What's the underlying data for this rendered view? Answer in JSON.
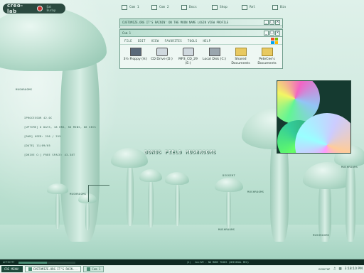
{
  "logo": {
    "name": "creo-lab",
    "tag": "Eat Burlap"
  },
  "desktop_icons": [
    {
      "label": "Com 1"
    },
    {
      "label": "Com 2"
    },
    {
      "label": "Docs"
    },
    {
      "label": "Shop"
    },
    {
      "label": "Rel"
    },
    {
      "label": "Bin"
    }
  ],
  "window_com1": {
    "title": "CUSTOMIZE.ORG  IT'S RAININ' ON THE MOON  NAME  LOGIN  VIEW  PROFILE",
    "controls": [
      "_",
      "□",
      "×"
    ]
  },
  "window_explorer": {
    "title": "Com 1",
    "controls": [
      "_",
      "□",
      "×"
    ],
    "menu": [
      "FILE",
      "EDIT",
      "VIEW",
      "FAVORITES",
      "TOOLS",
      "HELP"
    ],
    "drives": [
      {
        "name": "3½ Floppy (A:)",
        "icon": "floppy-icon"
      },
      {
        "name": "CD Drive (D:)",
        "icon": "cd-icon"
      },
      {
        "name": "MP3_CD_29 (E:)",
        "icon": "cd-icon"
      },
      {
        "name": "Local Disk (C:)",
        "icon": "harddisk-icon"
      },
      {
        "name": "Shared Documents",
        "icon": "folder-icon"
      },
      {
        "name": "PeteCee's Documents",
        "icon": "folder-icon"
      }
    ]
  },
  "sysinfo": [
    "IPROCESSOR 42.0C",
    "[UPTIME] 0 DAYS, 18 HRS, 56 MINS, 06 SECS",
    "[RAM] USED: 256 / 255",
    "[DATE] 11/09/05",
    "[DRIVE C:] FREE SPACE: 43.38T"
  ],
  "labels": {
    "mushrooms_left": "MUSHROOMS",
    "mushrooms_mid": "MUSHROOMS",
    "mushrooms_bottom": "MUSHROOMS",
    "mushrooms_right": "MUSHROOMS",
    "mushrooms_far": "MUSHROOMS",
    "mushrooms_low": "MUSHROOMS",
    "dessert": "DESSERT",
    "bonus": "BONUS FIELD MUSHROOMS"
  },
  "statusbar": {
    "activity": "ACTIVITY",
    "track": "ALLIVE - NO MORE TEARS (ORIGINAL MIX)",
    "track_index": "(1)",
    "playback_level": 0.5
  },
  "taskbar": {
    "start": "CRE MENU!",
    "tasks": [
      "CUSTOMIZE.ORG  IT'S RAIN...",
      "Com 1"
    ],
    "desktop_label": "DESKTOP",
    "clock": "3:18:10 PM"
  },
  "colors": {
    "accent": "#1e4a3c",
    "windows_red": "#f25022",
    "windows_green": "#7fba00",
    "windows_blue": "#00a4ef",
    "windows_yellow": "#ffb900"
  }
}
